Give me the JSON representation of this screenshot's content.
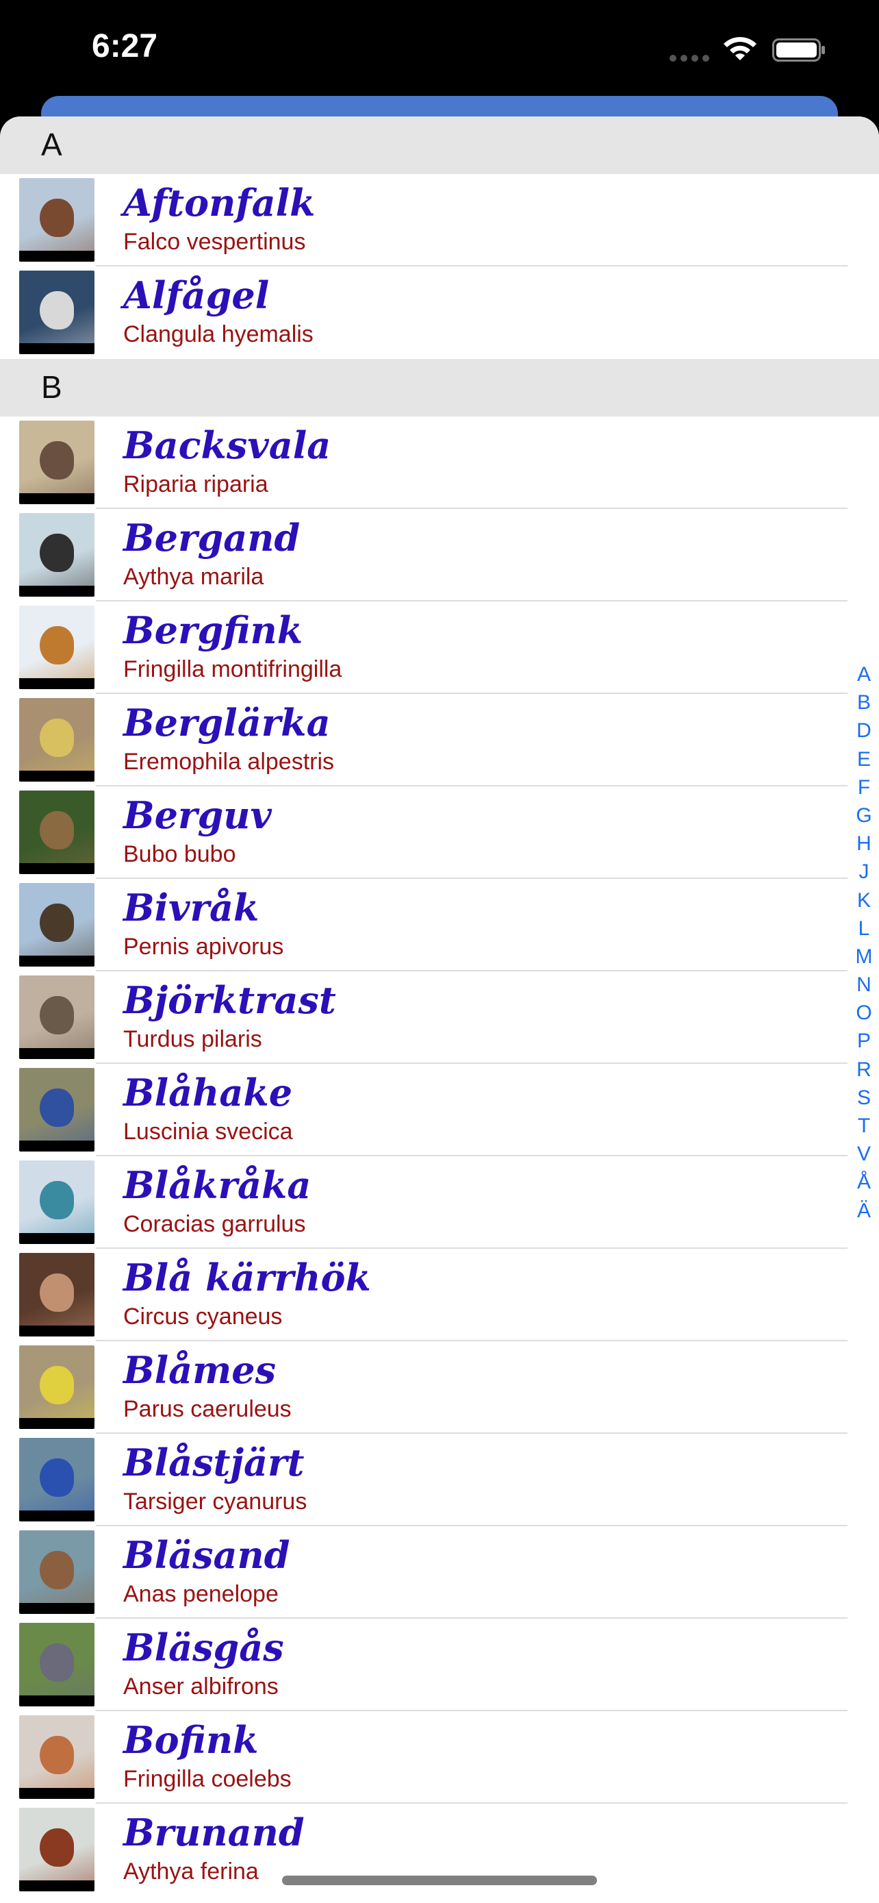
{
  "status": {
    "time": "6:27"
  },
  "index_letters": [
    "A",
    "B",
    "D",
    "E",
    "F",
    "G",
    "H",
    "J",
    "K",
    "L",
    "M",
    "N",
    "O",
    "P",
    "R",
    "S",
    "T",
    "V",
    "Å",
    "Ä"
  ],
  "sections": [
    {
      "letter": "A",
      "birds": [
        {
          "name": "Aftonfalk",
          "latin": "Falco vespertinus",
          "bg": "#b8c8d8",
          "fg": "#7a4a30"
        },
        {
          "name": "Alfågel",
          "latin": "Clangula hyemalis",
          "bg": "#2f4a6a",
          "fg": "#d8d8d8"
        }
      ]
    },
    {
      "letter": "B",
      "birds": [
        {
          "name": "Backsvala",
          "latin": "Riparia riparia",
          "bg": "#c8b898",
          "fg": "#6a5040"
        },
        {
          "name": "Bergand",
          "latin": "Aythya marila",
          "bg": "#c8d8e0",
          "fg": "#303030"
        },
        {
          "name": "Bergfink",
          "latin": "Fringilla montifringilla",
          "bg": "#e8eef4",
          "fg": "#c07a30"
        },
        {
          "name": "Berglärka",
          "latin": "Eremophila alpestris",
          "bg": "#a89070",
          "fg": "#d8c060"
        },
        {
          "name": "Berguv",
          "latin": "Bubo bubo",
          "bg": "#3a5a2a",
          "fg": "#8a6a40"
        },
        {
          "name": "Bivråk",
          "latin": "Pernis apivorus",
          "bg": "#a8c0d8",
          "fg": "#4a3a2a"
        },
        {
          "name": "Björktrast",
          "latin": "Turdus pilaris",
          "bg": "#c0b0a0",
          "fg": "#6a5a4a"
        },
        {
          "name": "Blåhake",
          "latin": "Luscinia svecica",
          "bg": "#8a8a6a",
          "fg": "#3050a0"
        },
        {
          "name": "Blåkråka",
          "latin": "Coracias garrulus",
          "bg": "#d0dce8",
          "fg": "#3a8aa0"
        },
        {
          "name": "Blå kärrhök",
          "latin": "Circus cyaneus",
          "bg": "#5a3a2a",
          "fg": "#c09070"
        },
        {
          "name": "Blåmes",
          "latin": "Parus caeruleus",
          "bg": "#a89878",
          "fg": "#e0d040"
        },
        {
          "name": "Blåstjärt",
          "latin": "Tarsiger cyanurus",
          "bg": "#6a8aa0",
          "fg": "#2a50b0"
        },
        {
          "name": "Bläsand",
          "latin": "Anas penelope",
          "bg": "#7a9aa8",
          "fg": "#8a6040"
        },
        {
          "name": "Bläsgås",
          "latin": "Anser albifrons",
          "bg": "#6a8a4a",
          "fg": "#6a6a7a"
        },
        {
          "name": "Bofink",
          "latin": "Fringilla coelebs",
          "bg": "#d8d0c8",
          "fg": "#c07040"
        },
        {
          "name": "Brunand",
          "latin": "Aythya ferina",
          "bg": "#d8dcd8",
          "fg": "#8a3a20"
        }
      ]
    }
  ]
}
